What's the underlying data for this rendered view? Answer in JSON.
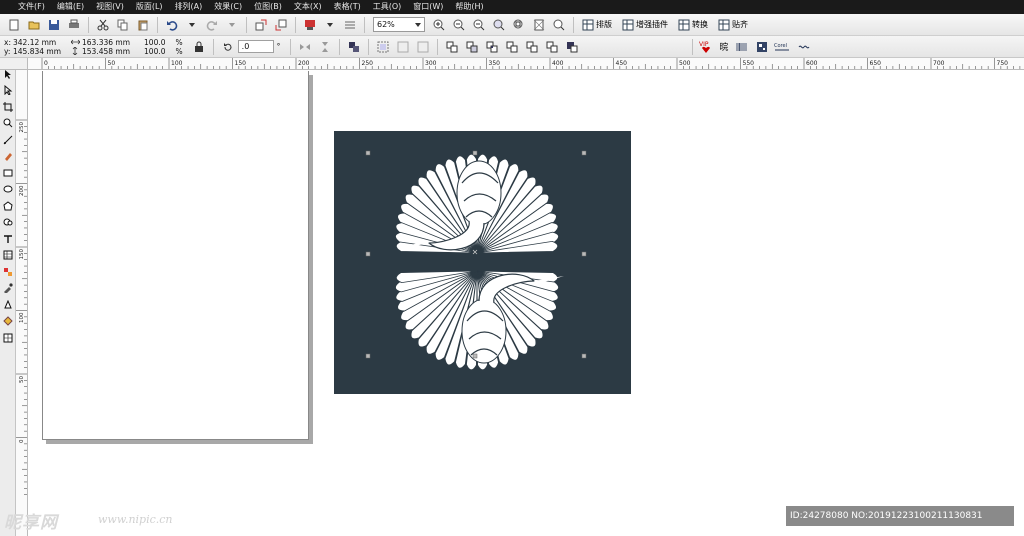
{
  "menu": [
    "文件(F)",
    "编辑(E)",
    "视图(V)",
    "版面(L)",
    "排列(A)",
    "效果(C)",
    "位图(B)",
    "文本(X)",
    "表格(T)",
    "工具(O)",
    "窗口(W)",
    "帮助(H)"
  ],
  "toolbar": {
    "zoom_value": "62%",
    "plugins": [
      "排版",
      "增强插件",
      "转换",
      "贴齐"
    ]
  },
  "property_bar": {
    "x_label": "x:",
    "x_value": "342.12 mm",
    "y_label": "y:",
    "y_value": "145.834 mm",
    "width_value": "163.336 mm",
    "height_value": "153.458 mm",
    "scale_x": "100.0",
    "scale_y": "100.0",
    "percent_sign": "%",
    "angle_value": ".0",
    "degree_sign": "°",
    "vip_label": "VIP",
    "corel_label": "Corel",
    "vip_extra": "晥"
  },
  "ruler_h_labels": [
    "0",
    "50",
    "100",
    "150",
    "200",
    "250",
    "300",
    "350",
    "400",
    "450",
    "500",
    "550",
    "600",
    "650",
    "700",
    "750"
  ],
  "ruler_v_labels": [
    "250",
    "200",
    "150",
    "100",
    "50",
    "0"
  ],
  "artwork": {
    "background_color": "#2c3a44",
    "motif_color": "#ffffff"
  },
  "watermark": {
    "brand": "昵享网",
    "url": "www.nipic.cn"
  },
  "image_id": "ID:24278080 NO:20191223100211130831"
}
